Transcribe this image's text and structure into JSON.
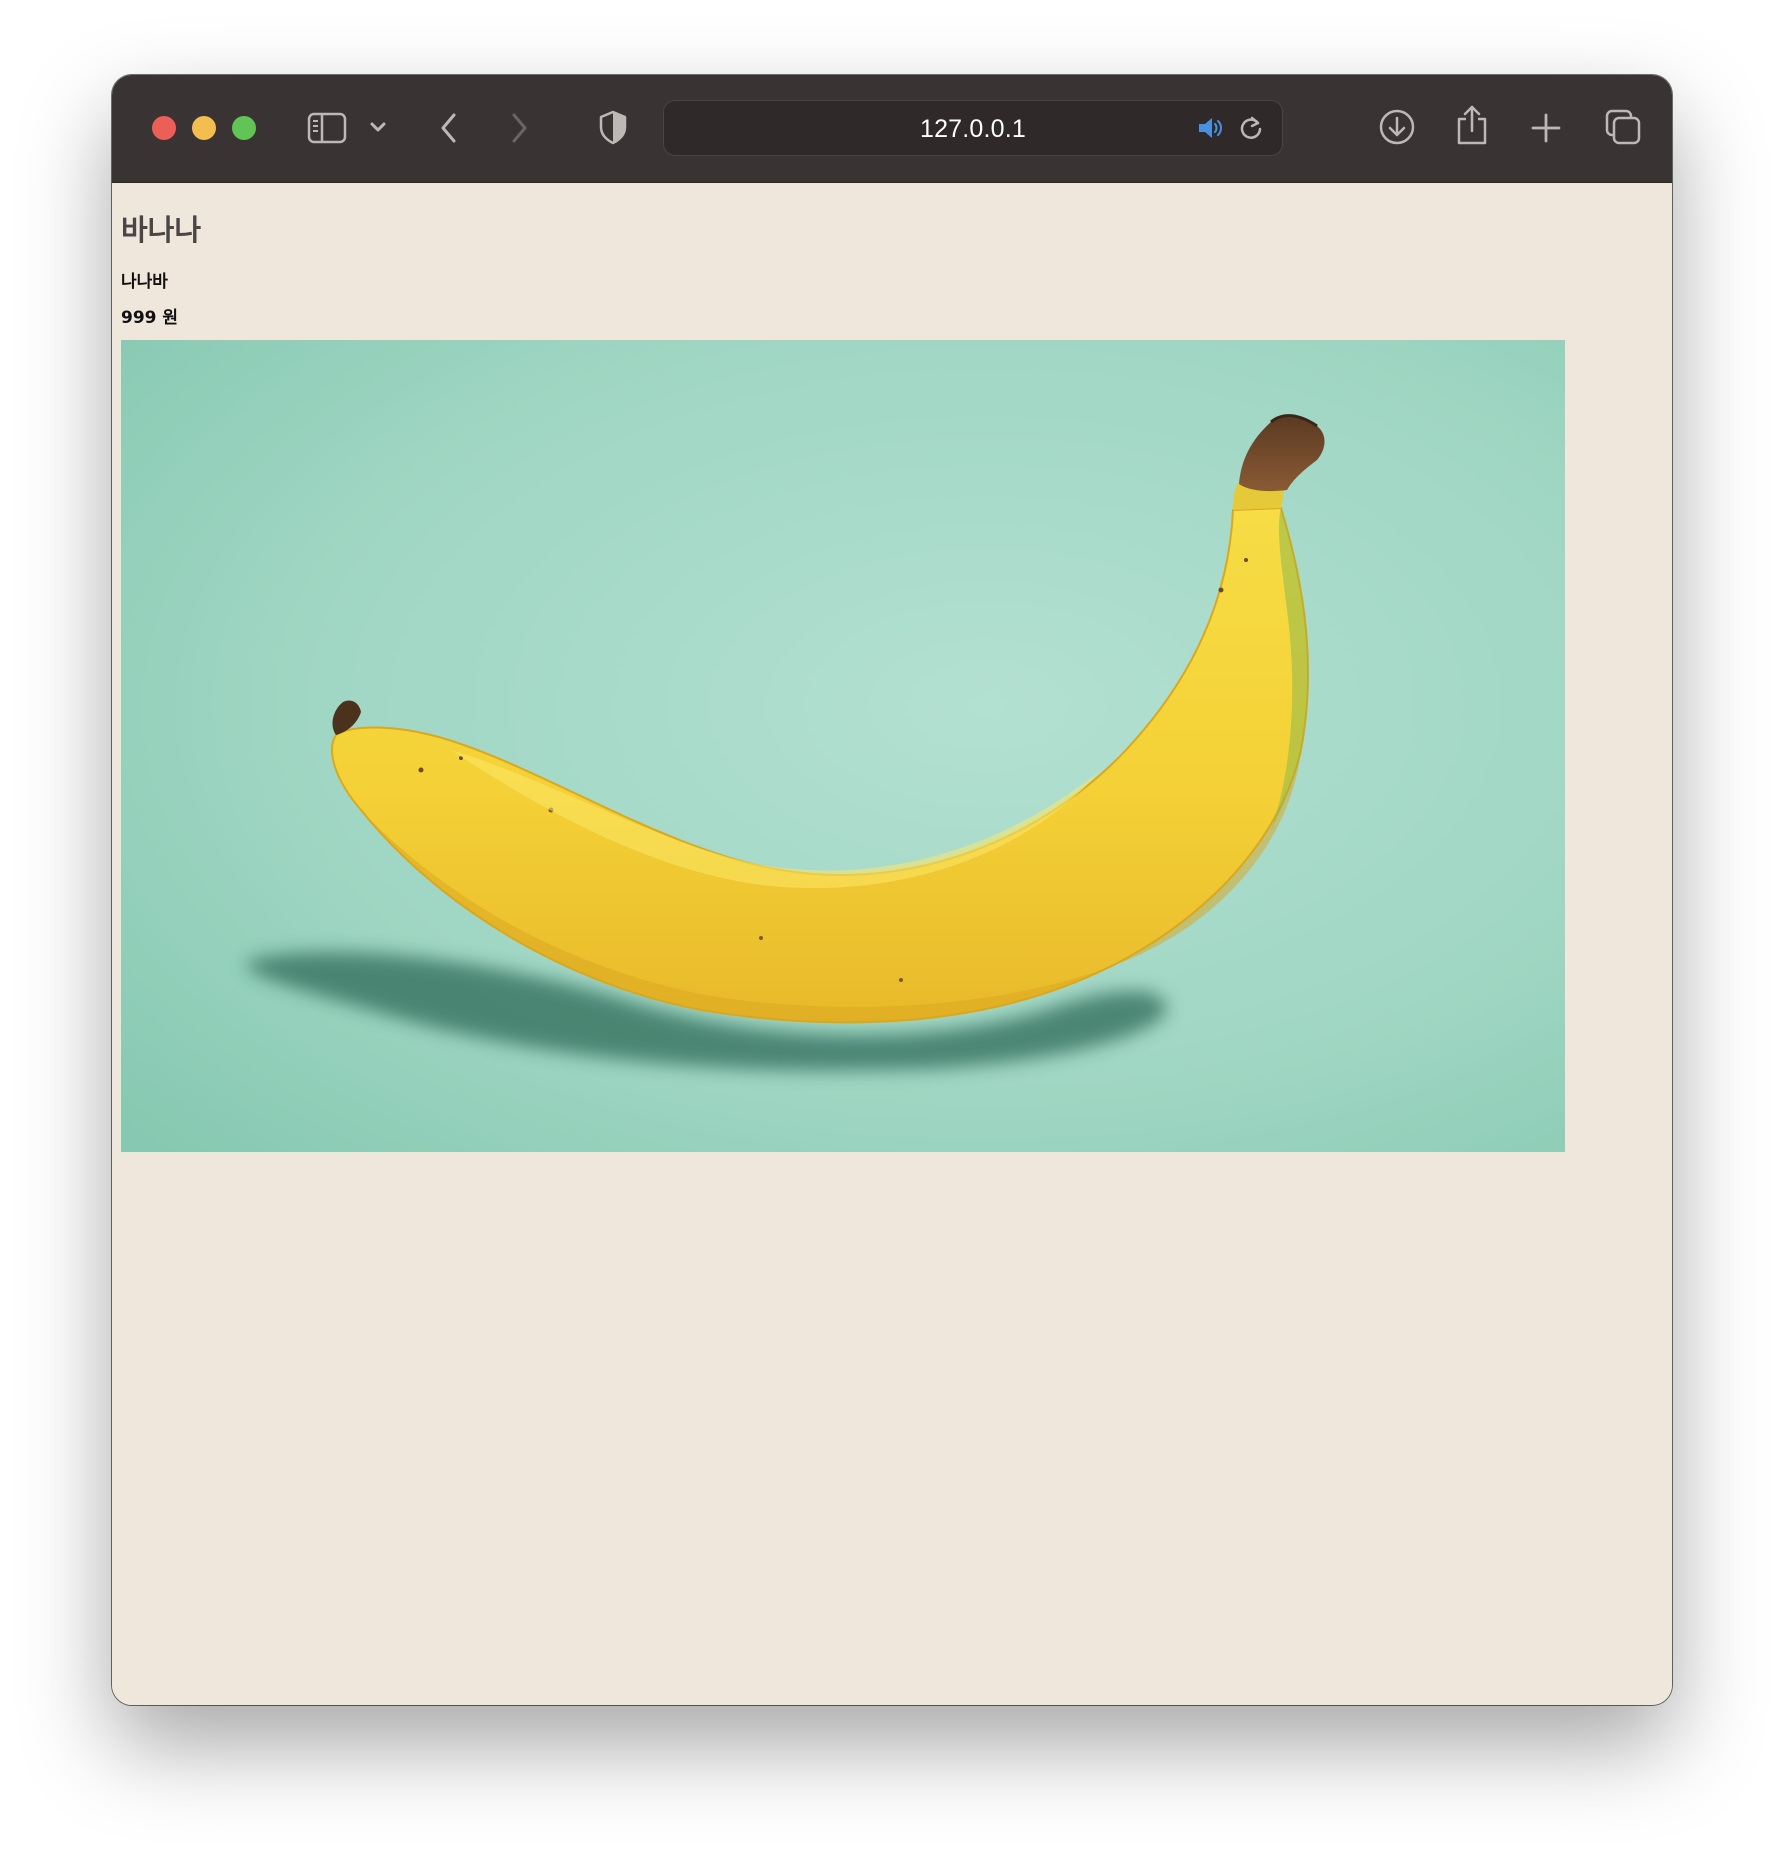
{
  "browser": {
    "url": "127.0.0.1",
    "traffic_lights": {
      "close_color": "#ec5f57",
      "minimize_color": "#f4bd4f",
      "zoom_color": "#61c454"
    },
    "toolbar_icons": [
      "sidebar-icon",
      "chevron-down-icon",
      "back-icon",
      "forward-icon",
      "shield-icon",
      "speaker-icon",
      "reload-icon",
      "download-icon",
      "share-icon",
      "new-tab-icon",
      "tab-overview-icon"
    ],
    "speaker_color": "#4a90e2"
  },
  "page": {
    "background": "#f0e7dc",
    "title": "바나나",
    "subtitle": "나나바",
    "price": "999 원",
    "image": {
      "subject": "banana-image",
      "background_color": "#a6d9c8",
      "fruit_color": "#f5d53a"
    }
  }
}
